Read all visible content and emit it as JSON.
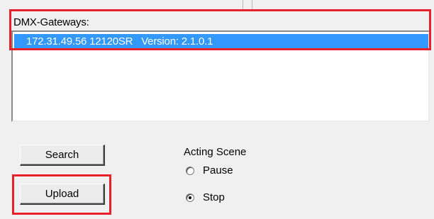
{
  "gateways": {
    "label": "DMX-Gateways:",
    "items": [
      {
        "text": "172.31.49.56 12120SR   Version: 2.1.0.1",
        "selected": true
      }
    ]
  },
  "buttons": {
    "search_label": "Search",
    "upload_label": "Upload"
  },
  "acting_scene": {
    "label": "Acting Scene",
    "options": [
      {
        "label": "Pause",
        "checked": false
      },
      {
        "label": "Stop",
        "checked": true
      }
    ]
  },
  "colors": {
    "selection": "#3399ff",
    "highlight_box": "#e8202a"
  }
}
